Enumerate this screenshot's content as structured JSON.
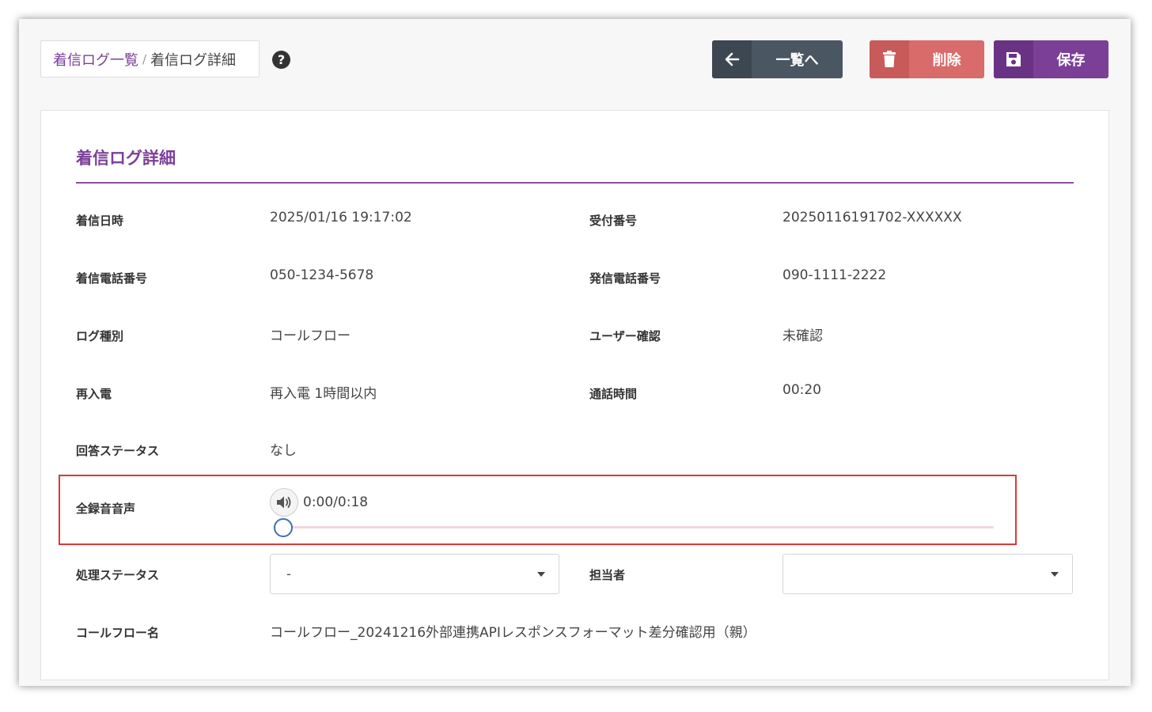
{
  "header": {
    "breadcrumb": {
      "link": "着信ログ一覧",
      "separator": "/",
      "current": "着信ログ詳細"
    },
    "help_icon": "?",
    "buttons": {
      "back_label": "一覧へ",
      "back_icon": "arrow-left-icon",
      "delete_label": "削除",
      "delete_icon": "trash-icon",
      "save_label": "保存",
      "save_icon": "floppy-disk-icon"
    }
  },
  "card": {
    "title": "着信ログ詳細",
    "fields": {
      "received_at_label": "着信日時",
      "received_at_value": "2025/01/16 19:17:02",
      "reception_no_label": "受付番号",
      "reception_no_value": "20250116191702-XXXXXX",
      "incoming_number_label": "着信電話番号",
      "incoming_number_value": "050-1234-5678",
      "caller_number_label": "発信電話番号",
      "caller_number_value": "090-1111-2222",
      "log_type_label": "ログ種別",
      "log_type_value": "コールフロー",
      "user_check_label": "ユーザー確認",
      "user_check_value": "未確認",
      "recall_label": "再入電",
      "recall_value": "再入電 1時間以内",
      "duration_label": "通話時間",
      "duration_value": "00:20",
      "answer_status_label": "回答ステータス",
      "answer_status_value": "なし",
      "recording_label": "全録音音声",
      "recording_time": "0:00/0:18",
      "recording_progress": 0,
      "process_status_label": "処理ステータス",
      "process_status_value": "-",
      "owner_label": "担当者",
      "owner_value": "",
      "callflow_name_label": "コールフロー名",
      "callflow_name_value": "コールフロー_20241216外部連携APIレスポンスフォーマット差分確認用（親）"
    }
  },
  "colors": {
    "brand": "#7b3f98",
    "delete": "#d96b6b",
    "back": "#4b5663",
    "highlight": "#d83a3a"
  }
}
